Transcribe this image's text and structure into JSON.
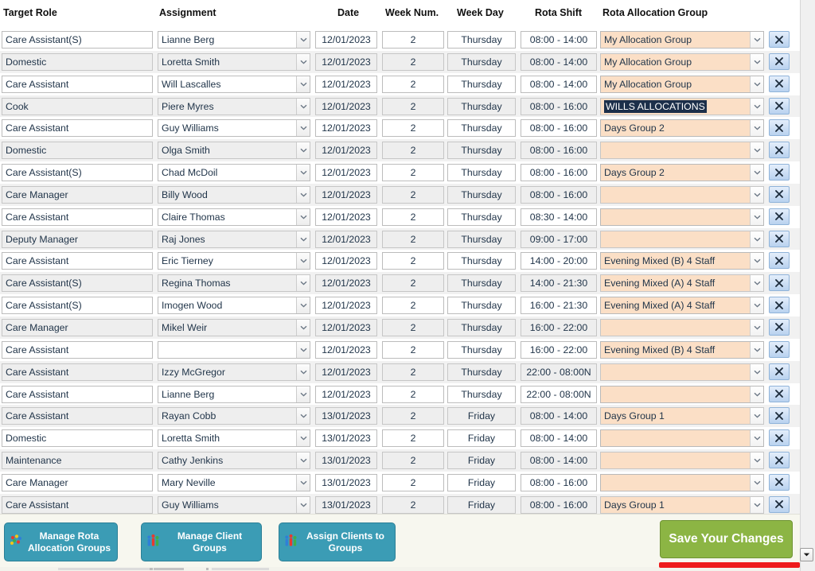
{
  "columns": [
    {
      "key": "target_role",
      "label": "Target Role"
    },
    {
      "key": "assignment",
      "label": "Assignment"
    },
    {
      "key": "date",
      "label": "Date"
    },
    {
      "key": "week_num",
      "label": "Week Num."
    },
    {
      "key": "week_day",
      "label": "Week Day"
    },
    {
      "key": "rota_shift",
      "label": "Rota Shift"
    },
    {
      "key": "alloc_group",
      "label": "Rota Allocation Group"
    }
  ],
  "rows": [
    {
      "target_role": "Care Assistant(S)",
      "assignment": "Lianne Berg",
      "date": "12/01/2023",
      "week_num": "2",
      "week_day": "Thursday",
      "rota_shift": "08:00 - 14:00",
      "alloc_group": "My Allocation Group",
      "alloc_selected": false
    },
    {
      "target_role": "Domestic",
      "assignment": "Loretta Smith",
      "date": "12/01/2023",
      "week_num": "2",
      "week_day": "Thursday",
      "rota_shift": "08:00 - 14:00",
      "alloc_group": "My Allocation Group",
      "alloc_selected": false
    },
    {
      "target_role": "Care Assistant",
      "assignment": "Will Lascalles",
      "date": "12/01/2023",
      "week_num": "2",
      "week_day": "Thursday",
      "rota_shift": "08:00 - 14:00",
      "alloc_group": "My Allocation Group",
      "alloc_selected": false
    },
    {
      "target_role": "Cook",
      "assignment": "Piere Myres",
      "date": "12/01/2023",
      "week_num": "2",
      "week_day": "Thursday",
      "rota_shift": "08:00 - 16:00",
      "alloc_group": "WILLS ALLOCATIONS",
      "alloc_selected": true
    },
    {
      "target_role": "Care Assistant",
      "assignment": "Guy Williams",
      "date": "12/01/2023",
      "week_num": "2",
      "week_day": "Thursday",
      "rota_shift": "08:00 - 16:00",
      "alloc_group": "Days Group 2",
      "alloc_selected": false
    },
    {
      "target_role": "Domestic",
      "assignment": "Olga Smith",
      "date": "12/01/2023",
      "week_num": "2",
      "week_day": "Thursday",
      "rota_shift": "08:00 - 16:00",
      "alloc_group": "",
      "alloc_selected": false
    },
    {
      "target_role": "Care Assistant(S)",
      "assignment": "Chad McDoil",
      "date": "12/01/2023",
      "week_num": "2",
      "week_day": "Thursday",
      "rota_shift": "08:00 - 16:00",
      "alloc_group": "Days Group 2",
      "alloc_selected": false
    },
    {
      "target_role": "Care Manager",
      "assignment": "Billy Wood",
      "date": "12/01/2023",
      "week_num": "2",
      "week_day": "Thursday",
      "rota_shift": "08:00 - 16:00",
      "alloc_group": "",
      "alloc_selected": false
    },
    {
      "target_role": "Care Assistant",
      "assignment": "Claire Thomas",
      "date": "12/01/2023",
      "week_num": "2",
      "week_day": "Thursday",
      "rota_shift": "08:30 - 14:00",
      "alloc_group": "",
      "alloc_selected": false
    },
    {
      "target_role": "Deputy Manager",
      "assignment": "Raj Jones",
      "date": "12/01/2023",
      "week_num": "2",
      "week_day": "Thursday",
      "rota_shift": "09:00 - 17:00",
      "alloc_group": "",
      "alloc_selected": false
    },
    {
      "target_role": "Care Assistant",
      "assignment": "Eric Tierney",
      "date": "12/01/2023",
      "week_num": "2",
      "week_day": "Thursday",
      "rota_shift": "14:00 - 20:00",
      "alloc_group": "Evening Mixed (B) 4 Staff",
      "alloc_selected": false
    },
    {
      "target_role": "Care Assistant(S)",
      "assignment": "Regina Thomas",
      "date": "12/01/2023",
      "week_num": "2",
      "week_day": "Thursday",
      "rota_shift": "14:00 - 21:30",
      "alloc_group": "Evening Mixed (A) 4 Staff",
      "alloc_selected": false
    },
    {
      "target_role": "Care Assistant(S)",
      "assignment": "Imogen Wood",
      "date": "12/01/2023",
      "week_num": "2",
      "week_day": "Thursday",
      "rota_shift": "16:00 - 21:30",
      "alloc_group": "Evening Mixed (A) 4 Staff",
      "alloc_selected": false
    },
    {
      "target_role": "Care Manager",
      "assignment": "Mikel Weir",
      "date": "12/01/2023",
      "week_num": "2",
      "week_day": "Thursday",
      "rota_shift": "16:00 - 22:00",
      "alloc_group": "",
      "alloc_selected": false
    },
    {
      "target_role": "Care Assistant",
      "assignment": "",
      "date": "12/01/2023",
      "week_num": "2",
      "week_day": "Thursday",
      "rota_shift": "16:00 - 22:00",
      "alloc_group": "Evening Mixed (B) 4 Staff",
      "alloc_selected": false
    },
    {
      "target_role": "Care Assistant",
      "assignment": "Izzy McGregor",
      "date": "12/01/2023",
      "week_num": "2",
      "week_day": "Thursday",
      "rota_shift": "22:00 - 08:00N",
      "alloc_group": "",
      "alloc_selected": false
    },
    {
      "target_role": "Care Assistant",
      "assignment": "Lianne Berg",
      "date": "12/01/2023",
      "week_num": "2",
      "week_day": "Thursday",
      "rota_shift": "22:00 - 08:00N",
      "alloc_group": "",
      "alloc_selected": false
    },
    {
      "target_role": "Care Assistant",
      "assignment": "Rayan Cobb",
      "date": "13/01/2023",
      "week_num": "2",
      "week_day": "Friday",
      "rota_shift": "08:00 - 14:00",
      "alloc_group": "Days Group 1",
      "alloc_selected": false
    },
    {
      "target_role": "Domestic",
      "assignment": "Loretta Smith",
      "date": "13/01/2023",
      "week_num": "2",
      "week_day": "Friday",
      "rota_shift": "08:00 - 14:00",
      "alloc_group": "",
      "alloc_selected": false
    },
    {
      "target_role": "Maintenance",
      "assignment": "Cathy Jenkins",
      "date": "13/01/2023",
      "week_num": "2",
      "week_day": "Friday",
      "rota_shift": "08:00 - 14:00",
      "alloc_group": "",
      "alloc_selected": false
    },
    {
      "target_role": "Care Manager",
      "assignment": "Mary Neville",
      "date": "13/01/2023",
      "week_num": "2",
      "week_day": "Friday",
      "rota_shift": "08:00 - 16:00",
      "alloc_group": "",
      "alloc_selected": false
    },
    {
      "target_role": "Care Assistant",
      "assignment": "Guy Williams",
      "date": "13/01/2023",
      "week_num": "2",
      "week_day": "Friday",
      "rota_shift": "08:00 - 16:00",
      "alloc_group": "Days Group 1",
      "alloc_selected": false
    }
  ],
  "row_action": {
    "delete_icon": "close-x-icon",
    "delete_label": "X"
  },
  "toolbar": {
    "buttons": [
      {
        "label": "Manage Rota Allocation Groups",
        "icon": "people-group-icon"
      },
      {
        "label": "Manage Client Groups",
        "icon": "people-group-icon"
      },
      {
        "label": "Assign Clients to Groups",
        "icon": "people-group-icon"
      }
    ],
    "save_label": "Save Your Changes"
  },
  "scrollbar": {
    "down_arrow_icon": "chevron-down-icon"
  },
  "colors": {
    "teal_button": "#3b9cb5",
    "save_green": "#8cb544",
    "alloc_peach": "#fbdfc6",
    "selection_navy": "#1c2f4a",
    "red_bar": "#ee1b1b",
    "alt_row": "#f1f1f1",
    "toolbar_bg": "#f7f7ef"
  }
}
